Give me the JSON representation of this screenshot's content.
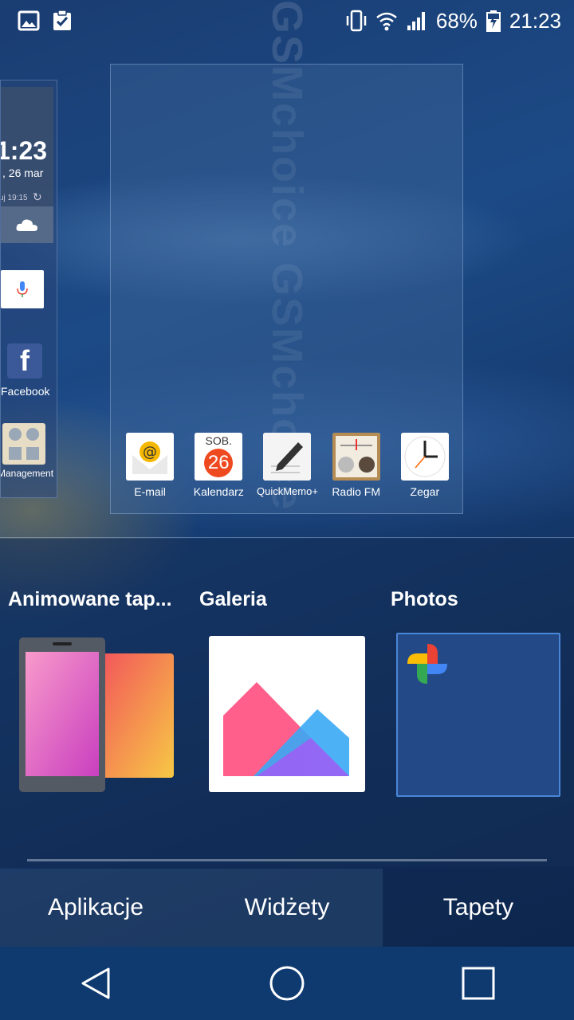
{
  "status_bar": {
    "battery_percent": "68%",
    "time": "21:23"
  },
  "left_panel": {
    "clock_time": "1:23",
    "clock_date": ", 26 mar",
    "update_text": "uj 19:15",
    "facebook_label": "Facebook",
    "management_label": "Management"
  },
  "dock": [
    {
      "label": "E-mail",
      "icon": "email-icon"
    },
    {
      "label": "Kalendarz",
      "icon": "calendar-icon",
      "day_name": "SOB.",
      "day_number": "26"
    },
    {
      "label": "QuickMemo+",
      "icon": "quickmemo-icon"
    },
    {
      "label": "Radio FM",
      "icon": "radio-icon"
    },
    {
      "label": "Zegar",
      "icon": "clock-icon"
    }
  ],
  "picker": {
    "animated_title": "Animowane tap...",
    "gallery_title": "Galeria",
    "photos_title": "Photos"
  },
  "tabs": [
    {
      "label": "Aplikacje",
      "active": false
    },
    {
      "label": "Widżety",
      "active": false
    },
    {
      "label": "Tapety",
      "active": true
    }
  ],
  "watermark": "GSMchoice GSMchoice",
  "colors": {
    "accent_border": "#4a86d8",
    "nav_bar": "#0f3a70",
    "facebook": "#3b5998"
  }
}
